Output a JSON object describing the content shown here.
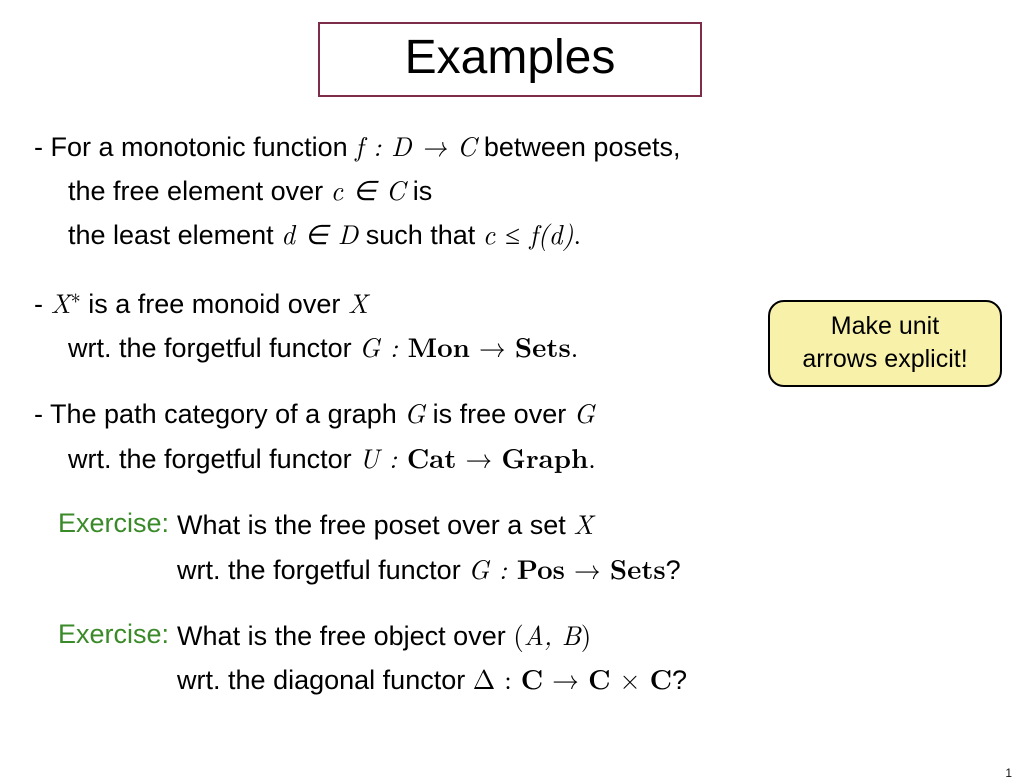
{
  "title": "Examples",
  "bullet1": {
    "l1a": "- For a monotonic function ",
    "l1_math": "f : D → C",
    "l1b": "  between posets,",
    "l2a": "the free element over ",
    "l2_math": "c ∈ C",
    "l2b": "  is",
    "l3a": "the least element ",
    "l3_math1": "d ∈ D",
    "l3b": " such that ",
    "l3_math2": "c ≤ f(d)",
    "l3c": "."
  },
  "bullet2": {
    "l1a": "- ",
    "l1_math_x": "X",
    "l1_star": "∗",
    "l1b": " is a free monoid over ",
    "l1_math_x2": "X",
    "l2a": "wrt. the forgetful functor ",
    "l2_math_g": "G : ",
    "l2_mon": "Mon",
    "l2_arrow": " → ",
    "l2_sets": "Sets",
    "l2_dot": "."
  },
  "callout": {
    "l1": "Make unit",
    "l2": "arrows explicit!"
  },
  "bullet3": {
    "l1a": "- The path category of a graph ",
    "l1_g": "G",
    "l1b": " is free over ",
    "l1_g2": "G",
    "l2a": "wrt. the forgetful functor  ",
    "l2_u": "U : ",
    "l2_cat": "Cat",
    "l2_arrow": " → ",
    "l2_graph": "Graph",
    "l2_dot": "."
  },
  "ex1": {
    "label": "Exercise: ",
    "l1a": "What is the free poset over a set  ",
    "l1_x": "X",
    "l2a": "wrt. the forgetful functor ",
    "l2_g": "G : ",
    "l2_pos": "Pos",
    "l2_arrow": " → ",
    "l2_sets": "Sets",
    "l2_q": "?"
  },
  "ex2": {
    "label": "Exercise: ",
    "l1a": "What is the free object over ",
    "l1_ab": "(A, B)",
    "l2a": "wrt. the diagonal functor ",
    "l2_delta": "Δ : ",
    "l2_c": "C",
    "l2_arrow": " → ",
    "l2_c2": "C",
    "l2_times": " × ",
    "l2_c3": "C",
    "l2_q": "?"
  },
  "page": "1"
}
